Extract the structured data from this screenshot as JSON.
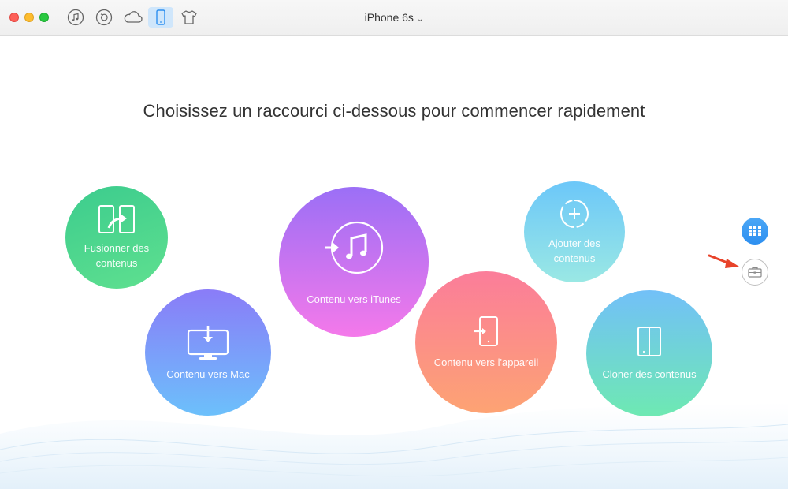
{
  "window": {
    "device_title": "iPhone 6s",
    "device_chevron": "⌄"
  },
  "toolbar": {
    "icons": [
      "music-icon",
      "restore-icon",
      "cloud-icon",
      "phone-icon",
      "tshirt-icon"
    ],
    "active": "phone-icon"
  },
  "main": {
    "headline": "Choisissez un raccourci ci-dessous pour commencer rapidement",
    "shortcuts": [
      {
        "label_line1": "Fusionner des",
        "label_line2": "contenus",
        "icon": "merge-icon"
      },
      {
        "label": "Contenu vers Mac",
        "icon": "monitor-download-icon"
      },
      {
        "label": "Contenu vers iTunes",
        "icon": "itunes-transfer-icon"
      },
      {
        "label": "Contenu vers l'appareil",
        "icon": "device-transfer-icon"
      },
      {
        "label_line1": "Ajouter des",
        "label_line2": "contenus",
        "icon": "add-icon"
      },
      {
        "label": "Cloner des contenus",
        "icon": "clone-icon"
      }
    ]
  },
  "sidebar": {
    "buttons": [
      "grid-icon",
      "toolbox-icon"
    ]
  },
  "colors": {
    "accent": "#2d8ff0",
    "annotation_arrow": "#e8432a"
  }
}
